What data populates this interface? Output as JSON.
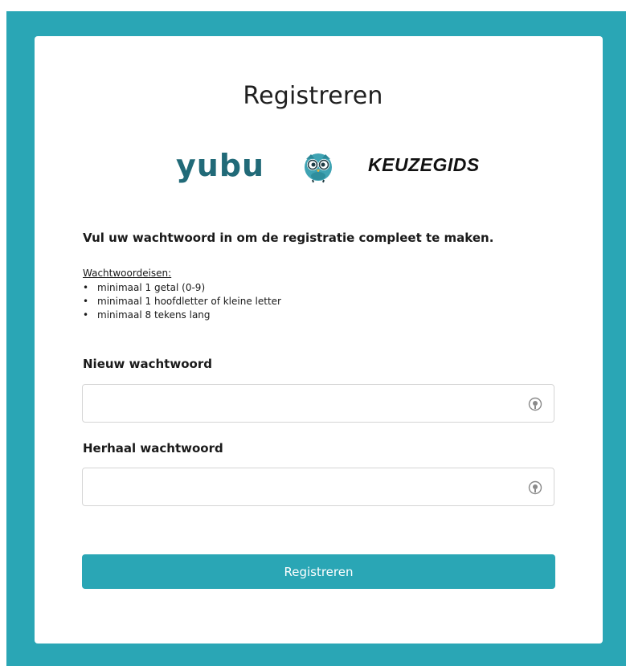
{
  "page": {
    "title": "Registreren"
  },
  "logos": {
    "yubu": "yubu",
    "keuzegids": "KEUZEGIDS"
  },
  "intro": "Vul uw wachtwoord in om de registratie compleet te maken.",
  "requirements": {
    "heading": "Wachtwoordeisen:",
    "items": [
      "minimaal 1 getal (0-9)",
      "minimaal 1 hoofdletter of kleine letter",
      "minimaal 8 tekens lang"
    ]
  },
  "form": {
    "new_password": {
      "label": "Nieuw wachtwoord",
      "value": "",
      "placeholder": ""
    },
    "repeat_password": {
      "label": "Herhaal wachtwoord",
      "value": "",
      "placeholder": ""
    },
    "submit_label": "Registreren"
  },
  "colors": {
    "accent": "#2aa6b5",
    "yubu_brand": "#216a78"
  },
  "icons": {
    "field_toggle": "eye-icon",
    "owl_logo": "owl-icon"
  }
}
